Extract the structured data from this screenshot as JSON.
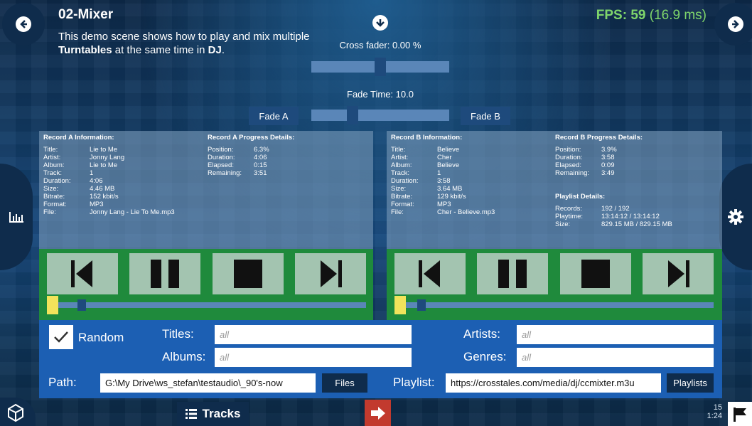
{
  "header": {
    "title": "02-Mixer",
    "desc_line1": "This demo scene shows how to play and mix multiple",
    "desc_bold1": "Turntables",
    "desc_mid": " at the same time in ",
    "desc_bold2": "DJ",
    "desc_end": ".",
    "fps_label": "FPS: 59",
    "fps_ms": " (16.9 ms)"
  },
  "mixer": {
    "crossfader_label": "Cross fader: 0.00 %",
    "crossfader_value": 0.5,
    "fade_time_label": "Fade Time: 10.0",
    "fade_time_value": 0.28,
    "fade_a": "Fade A",
    "fade_b": "Fade B"
  },
  "recordA": {
    "info_title": "Record A Information:",
    "info": [
      {
        "k": "Title:",
        "v": "Lie to Me"
      },
      {
        "k": "Artist:",
        "v": "Jonny Lang"
      },
      {
        "k": "Album:",
        "v": "Lie to Me"
      },
      {
        "k": "Track:",
        "v": "1"
      },
      {
        "k": "Duration:",
        "v": "4:06"
      },
      {
        "k": "Size:",
        "v": "4.46 MB"
      },
      {
        "k": "Bitrate:",
        "v": "152 kbit/s"
      },
      {
        "k": "Format:",
        "v": "MP3"
      },
      {
        "k": "File:",
        "v": "Jonny Lang - Lie To Me.mp3"
      }
    ],
    "progress_title": "Record A Progress Details:",
    "progress": [
      {
        "k": "Position:",
        "v": "6.3%"
      },
      {
        "k": "Duration:",
        "v": "4:06"
      },
      {
        "k": "Elapsed:",
        "v": "0:15"
      },
      {
        "k": "Remaining:",
        "v": "3:51"
      }
    ],
    "position_fraction": 0.063
  },
  "recordB": {
    "info_title": "Record B Information:",
    "info": [
      {
        "k": "Title:",
        "v": "Believe"
      },
      {
        "k": "Artist:",
        "v": "Cher"
      },
      {
        "k": "Album:",
        "v": "Believe"
      },
      {
        "k": "Track:",
        "v": "1"
      },
      {
        "k": "Duration:",
        "v": "3:58"
      },
      {
        "k": "Size:",
        "v": "3.64 MB"
      },
      {
        "k": "Bitrate:",
        "v": "129 kbit/s"
      },
      {
        "k": "Format:",
        "v": "MP3"
      },
      {
        "k": "File:",
        "v": "Cher - Believe.mp3"
      }
    ],
    "progress_title": "Record B Progress Details:",
    "progress": [
      {
        "k": "Position:",
        "v": "3.9%"
      },
      {
        "k": "Duration:",
        "v": "3:58"
      },
      {
        "k": "Elapsed:",
        "v": "0:09"
      },
      {
        "k": "Remaining:",
        "v": "3:49"
      }
    ],
    "playlist_title": "Playlist Details:",
    "playlist": [
      {
        "k": "Records:",
        "v": "192 / 192"
      },
      {
        "k": "Playtime:",
        "v": "13:14:12 / 13:14:12"
      },
      {
        "k": "Size:",
        "v": "829.15 MB / 829.15 MB"
      }
    ],
    "position_fraction": 0.039
  },
  "filters": {
    "random_label": "Random",
    "random_checked": true,
    "titles_label": "Titles:",
    "titles_placeholder": "all",
    "albums_label": "Albums:",
    "albums_placeholder": "all",
    "artists_label": "Artists:",
    "artists_placeholder": "all",
    "genres_label": "Genres:",
    "genres_placeholder": "all",
    "path_label": "Path:",
    "path_value": "G:\\My Drive\\ws_stefan\\testaudio\\_90's-now",
    "files_button": "Files",
    "playlist_label": "Playlist:",
    "playlist_value": "https://crosstales.com/media/dj/ccmixter.m3u",
    "playlists_button": "Playlists"
  },
  "footer": {
    "tracks_label": "Tracks",
    "counter_top": "15",
    "counter_bottom": "1:24"
  },
  "icons": {
    "back": "arrow-left-circle-icon",
    "forward": "arrow-right-circle-icon",
    "download": "arrow-down-circle-icon",
    "stats": "bar-chart-icon",
    "settings": "gear-icon",
    "unity": "unity-logo-icon",
    "list": "list-icon",
    "exit": "exit-icon",
    "flag": "flag-icon"
  },
  "colors": {
    "fps": "#7fd66b",
    "control_panel": "#1f8a3c",
    "filter_panel": "#1c5fb3",
    "progress_marker": "#f2e35b",
    "exit": "#c23a2e"
  }
}
